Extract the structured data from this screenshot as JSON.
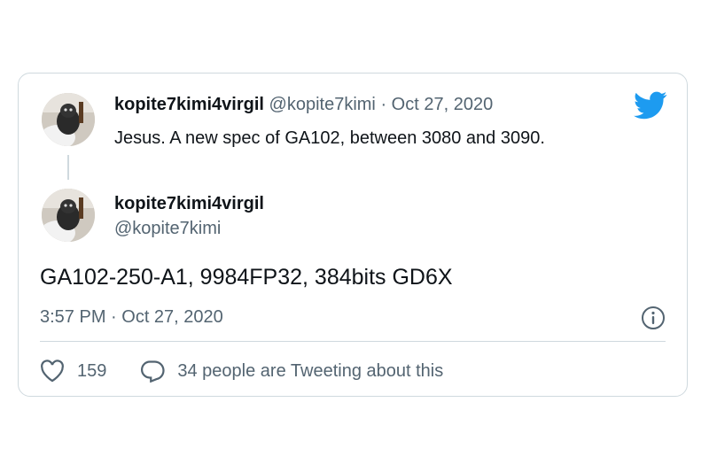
{
  "reply_tweet": {
    "display_name": "kopite7kimi4virgil",
    "handle": "@kopite7kimi",
    "separator": "·",
    "date": "Oct 27, 2020",
    "text": "Jesus. A new spec of GA102, between 3080 and 3090."
  },
  "main_tweet": {
    "display_name": "kopite7kimi4virgil",
    "handle": "@kopite7kimi",
    "text": "GA102-250-A1, 9984FP32, 384bits GD6X",
    "timestamp": "3:57 PM · Oct 27, 2020"
  },
  "actions": {
    "like_count": "159",
    "reply_label": "34 people are Tweeting about this"
  },
  "icons": {
    "brand": "twitter-bird-icon",
    "info": "info-icon",
    "like": "heart-icon",
    "reply": "speech-bubble-icon"
  },
  "colors": {
    "twitter_blue": "#1d9bf0",
    "text_primary": "#0f1419",
    "text_secondary": "#536471",
    "border": "#cfd9de"
  }
}
